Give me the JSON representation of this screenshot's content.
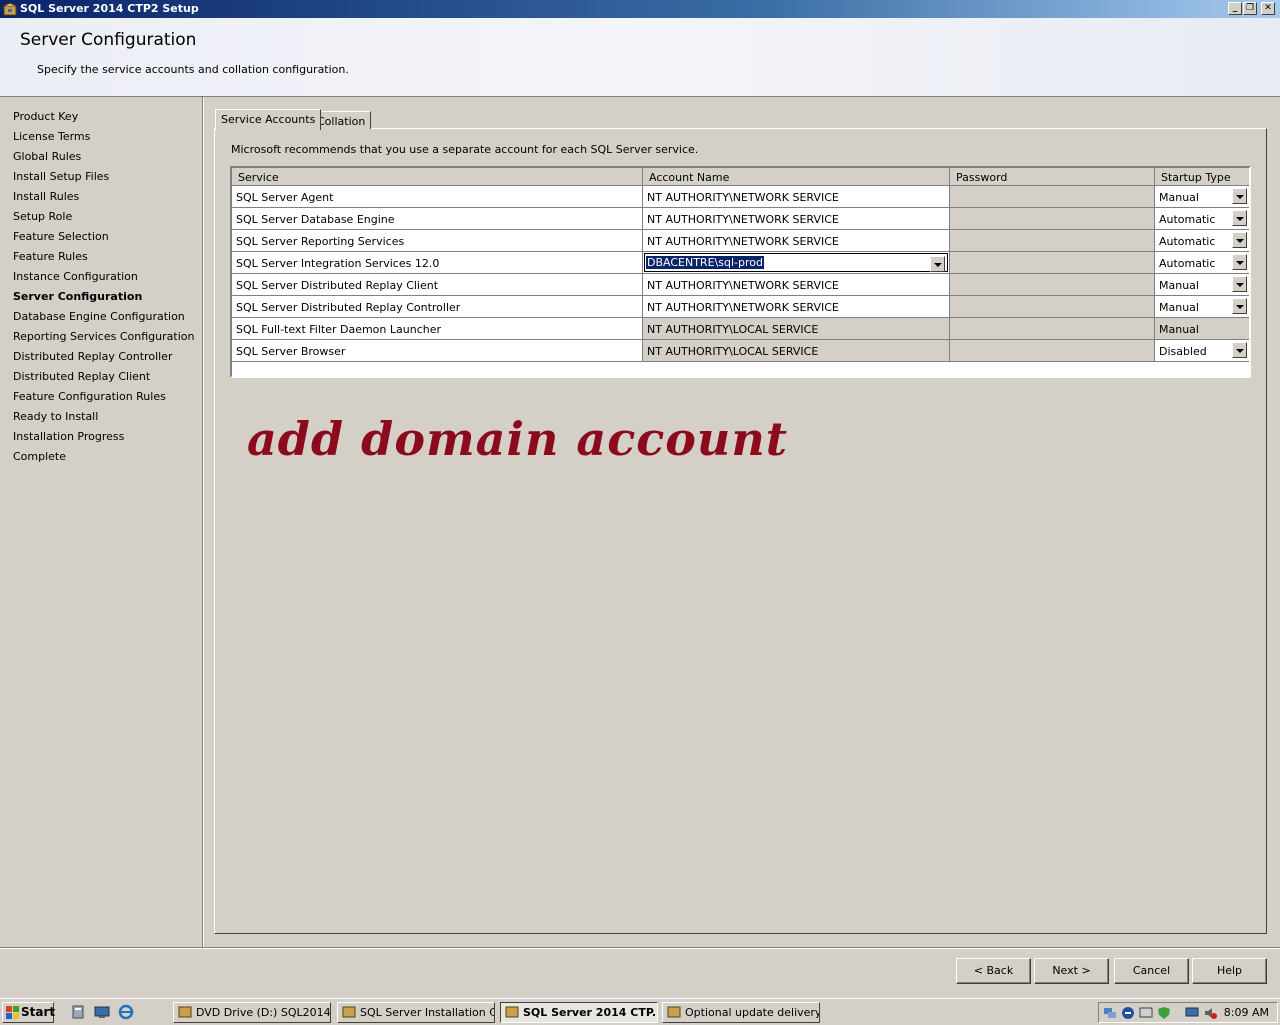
{
  "window": {
    "title": "SQL Server 2014 CTP2 Setup",
    "minimize": "_",
    "restore": "❐",
    "close": "✕"
  },
  "header": {
    "title": "Server Configuration",
    "subtitle": "Specify the service accounts and collation configuration."
  },
  "nav": {
    "items": [
      {
        "label": "Product Key",
        "active": false
      },
      {
        "label": "License Terms",
        "active": false
      },
      {
        "label": "Global Rules",
        "active": false
      },
      {
        "label": "Install Setup Files",
        "active": false
      },
      {
        "label": "Install Rules",
        "active": false
      },
      {
        "label": "Setup Role",
        "active": false
      },
      {
        "label": "Feature Selection",
        "active": false
      },
      {
        "label": "Feature Rules",
        "active": false
      },
      {
        "label": "Instance Configuration",
        "active": false
      },
      {
        "label": "Server Configuration",
        "active": true
      },
      {
        "label": "Database Engine Configuration",
        "active": false
      },
      {
        "label": "Reporting Services Configuration",
        "active": false
      },
      {
        "label": "Distributed Replay Controller",
        "active": false
      },
      {
        "label": "Distributed Replay Client",
        "active": false
      },
      {
        "label": "Feature Configuration Rules",
        "active": false
      },
      {
        "label": "Ready to Install",
        "active": false
      },
      {
        "label": "Installation Progress",
        "active": false
      },
      {
        "label": "Complete",
        "active": false
      }
    ]
  },
  "tabs": [
    {
      "label": "Service Accounts",
      "selected": true
    },
    {
      "label": "Collation",
      "selected": false
    }
  ],
  "recommendation": "Microsoft recommends that you use a separate account for each SQL Server service.",
  "grid": {
    "columns": [
      "Service",
      "Account Name",
      "Password",
      "Startup Type"
    ],
    "rows": [
      {
        "service": "SQL Server Agent",
        "account": "NT AUTHORITY\\NETWORK SERVICE",
        "startup": "Manual",
        "editable": true
      },
      {
        "service": "SQL Server Database Engine",
        "account": "NT AUTHORITY\\NETWORK SERVICE",
        "startup": "Automatic",
        "editable": true
      },
      {
        "service": "SQL Server Reporting Services",
        "account": "NT AUTHORITY\\NETWORK SERVICE",
        "startup": "Automatic",
        "editable": true
      },
      {
        "service": "SQL Server Integration Services 12.0",
        "account": "DBACENTRE\\sql-prod",
        "startup": "Automatic",
        "editable": true
      },
      {
        "service": "SQL Server Distributed Replay Client",
        "account": "NT AUTHORITY\\NETWORK SERVICE",
        "startup": "Manual",
        "editable": true
      },
      {
        "service": "SQL Server Distributed Replay Controller",
        "account": "NT AUTHORITY\\NETWORK SERVICE",
        "startup": "Manual",
        "editable": true
      },
      {
        "service": "SQL Full-text Filter Daemon Launcher",
        "account": "NT AUTHORITY\\LOCAL SERVICE",
        "startup": "Manual",
        "editable": false
      },
      {
        "service": "SQL Server Browser",
        "account": "NT AUTHORITY\\LOCAL SERVICE",
        "startup": "Disabled",
        "editable": false
      }
    ]
  },
  "annotation": "add domain account",
  "buttons": {
    "back": "< Back",
    "next": "Next >",
    "cancel": "Cancel",
    "help": "Help"
  },
  "taskbar": {
    "start": "Start",
    "tasks": [
      {
        "label": "DVD Drive (D:) SQL2014...",
        "active": false
      },
      {
        "label": "SQL Server Installation C...",
        "active": false
      },
      {
        "label": "SQL Server 2014 CTP...",
        "active": true
      },
      {
        "label": "Optional update delivery...",
        "active": false
      }
    ],
    "clock": "8:09 AM"
  },
  "colors": {
    "annotation": "#8b0a1e",
    "selection": "#0a246a",
    "titlebar": "#0a246a"
  }
}
